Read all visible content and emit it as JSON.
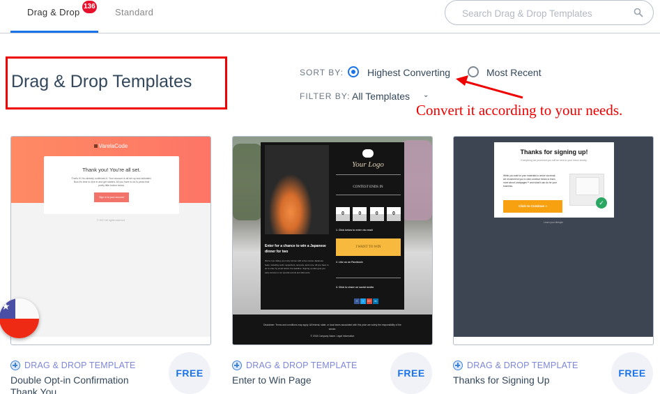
{
  "tabs": [
    {
      "label": "Drag & Drop",
      "badge": "136",
      "active": true
    },
    {
      "label": "Standard",
      "active": false
    }
  ],
  "search": {
    "placeholder": "Search Drag & Drop Templates"
  },
  "heading": "Drag & Drop Templates",
  "sort": {
    "label": "SORT BY:",
    "options": [
      {
        "label": "Highest Converting",
        "selected": true
      },
      {
        "label": "Most Recent",
        "selected": false
      }
    ]
  },
  "filter": {
    "label": "FILTER BY:",
    "value": "All Templates"
  },
  "annotation": {
    "text": "Convert it according to your needs.",
    "color": "#ee0000"
  },
  "colors": {
    "accent": "#1a73e8",
    "badge": "#e8112d",
    "type_label": "#7d87d8"
  },
  "cards": [
    {
      "type": "DRAG & DROP TEMPLATE",
      "name": "Double Opt-in Confirmation Thank You",
      "price": "FREE",
      "preview": {
        "logo": "VarelaCode",
        "title": "Thank you! You're all set.",
        "body": "That's it! You already confirmed it. Your account is all set up and activated. Now it's time to dive in and get started. All you have to do is press that pretty little button below.",
        "button": "Sign in to your account",
        "footer": "© 2017 All rights reserved"
      }
    },
    {
      "type": "DRAG & DROP TEMPLATE",
      "name": "Enter to Win Page",
      "price": "FREE",
      "preview": {
        "logo": "Your Logo",
        "contest": "CONTEST ENDS IN",
        "digits": [
          "0",
          "0",
          "0",
          "0"
        ],
        "step1": "1. Click below to enter via email",
        "cta": "I WANT TO WIN",
        "step2": "2. Like us on Facebook",
        "step3": "3. Click to share on social media",
        "headline": "Enter for a chance to win a Japanese dinner for two",
        "paragraph": "We're now rolling one lucky winner with a five-course Japanese feast, including sushi, appetizers, tempura, and more. All you have to do is enter by email before the deadline. Signing up also gets you early access to our special events and discounts.",
        "social": [
          "f",
          "t",
          "G+",
          "in"
        ],
        "disclaimer": "Disclaimer: Terms and conditions may apply. All federal, state, or local taxes associated with this prize are solely the responsibility of the winner.",
        "copyright": "© 2018 Company Name. Legal Information"
      }
    },
    {
      "type": "DRAG & DROP TEMPLATE",
      "name": "Thanks for Signing Up",
      "price": "FREE",
      "preview": {
        "title": "Thanks for signing up!",
        "subtitle": "Everything we promised you will be sent to your inbox shortly.",
        "body": "While you wait for your materials to arrive via email, we recommend you to click continue below to learn more about Leadpages™ and what it can do for your business.",
        "button": "Click to Continue »",
        "footer": "Learn your lifestyle"
      }
    }
  ]
}
